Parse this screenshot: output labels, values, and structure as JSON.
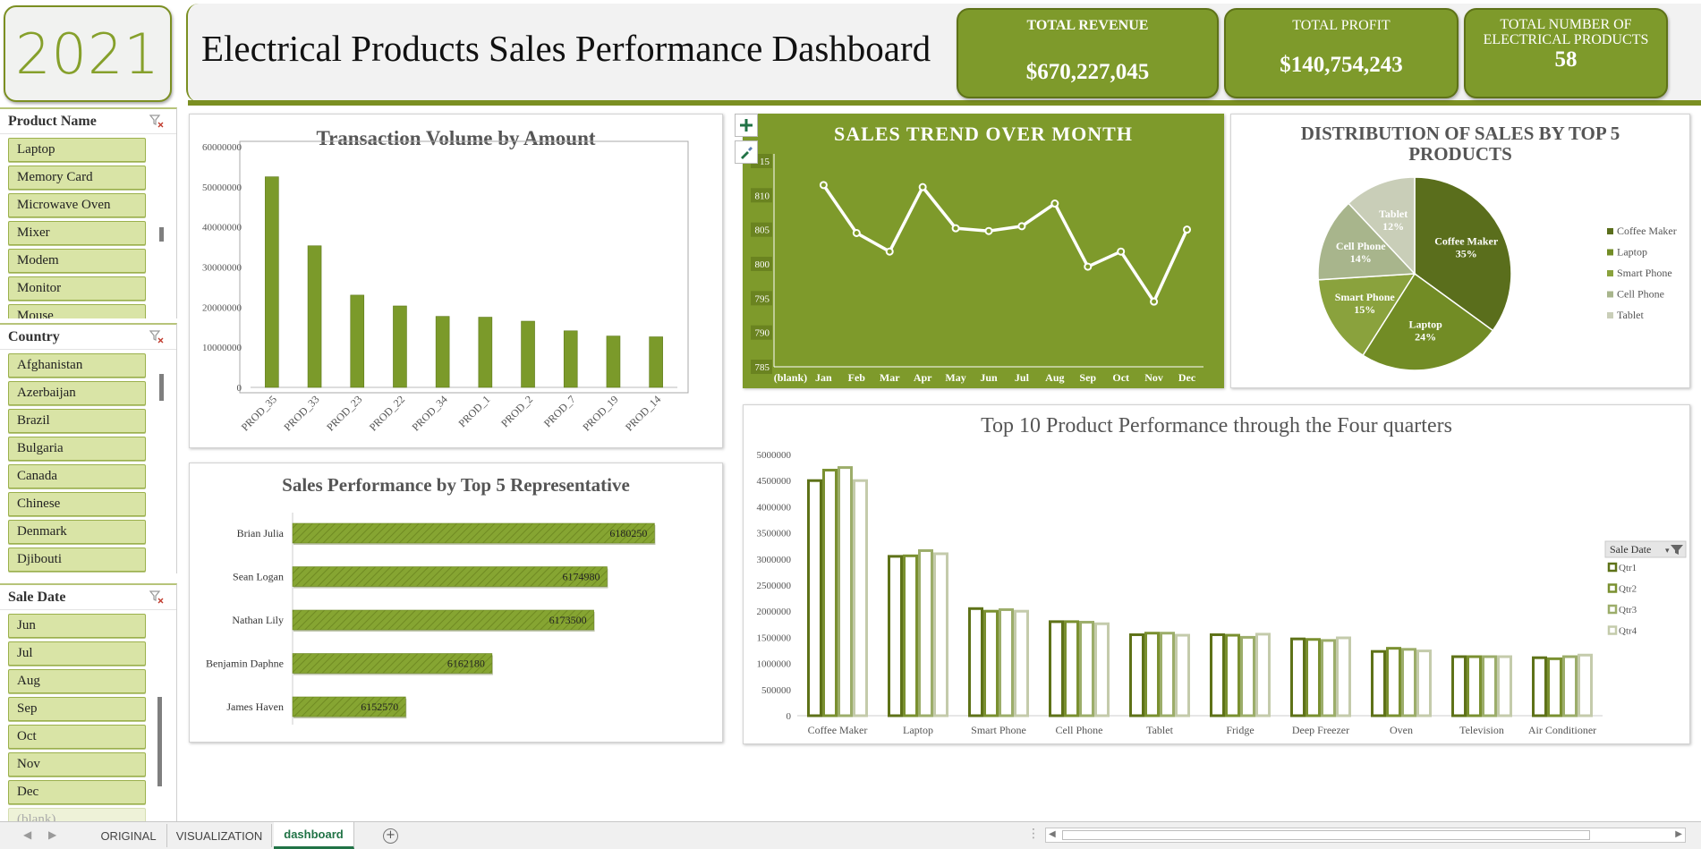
{
  "header": {
    "year": "2021",
    "title": "Electrical Products Sales Performance Dashboard",
    "kpis": {
      "revenue_label": "TOTAL REVENUE",
      "revenue_value": "$670,227,045",
      "profit_label": "TOTAL PROFIT",
      "profit_value": "$140,754,243",
      "count_label_1": "TOTAL NUMBER OF",
      "count_label_2": "ELECTRICAL PRODUCTS",
      "count_value": "58"
    }
  },
  "slicers": {
    "product": {
      "title": "Product Name",
      "items": [
        "Laptop",
        "Memory Card",
        "Microwave Oven",
        "Mixer",
        "Modem",
        "Monitor",
        "Mouse"
      ]
    },
    "country": {
      "title": "Country",
      "items": [
        "Afghanistan",
        "Azerbaijan",
        "Brazil",
        "Bulgaria",
        "Canada",
        "Chinese",
        "Denmark",
        "Djibouti"
      ]
    },
    "sale_date": {
      "title": "Sale Date",
      "items": [
        "Jun",
        "Jul",
        "Aug",
        "Sep",
        "Oct",
        "Nov",
        "Dec",
        "(blank)"
      ]
    }
  },
  "colors": {
    "accent": "#7e9a2b",
    "dark_green": "#5e7218",
    "slicer_item": "#d9e4a6"
  },
  "chart_data": [
    {
      "id": "transaction-volume",
      "type": "bar",
      "title": "Transaction Volume by Amount",
      "categories": [
        "PROD_35",
        "PROD_33",
        "PROD_23",
        "PROD_22",
        "PROD_34",
        "PROD_1",
        "PROD_2",
        "PROD_7",
        "PROD_19",
        "PROD_14"
      ],
      "values": [
        52500000,
        35300000,
        23000000,
        20300000,
        17700000,
        17500000,
        16500000,
        14100000,
        12800000,
        12600000
      ],
      "ylim": [
        0,
        60000000
      ],
      "yticks": [
        "0",
        "10000000",
        "20000000",
        "30000000",
        "40000000",
        "50000000",
        "60000000"
      ]
    },
    {
      "id": "sales-trend",
      "type": "line",
      "title": "SALES TREND OVER MONTH",
      "categories": [
        "(blank)",
        "Jan",
        "Feb",
        "Mar",
        "Apr",
        "May",
        "Jun",
        "Jul",
        "Aug",
        "Sep",
        "Oct",
        "Nov",
        "Dec"
      ],
      "values": [
        null,
        811.5,
        804.5,
        801.8,
        811.2,
        805.2,
        804.8,
        805.5,
        808.8,
        799.6,
        801.8,
        794.5,
        805.0
      ],
      "ylim": [
        785,
        815
      ],
      "yticks": [
        "785",
        "790",
        "795",
        "800",
        "805",
        "810",
        "15"
      ]
    },
    {
      "id": "sales-distribution",
      "type": "pie",
      "title": "DISTRIBUTION OF SALES BY TOP  5 PRODUCTS",
      "labels": [
        "Coffee Maker",
        "Laptop",
        "Smart Phone",
        "Cell Phone",
        "Tablet"
      ],
      "percent_labels": [
        "35%",
        "24%",
        "15%",
        "14%",
        "12%"
      ],
      "values": [
        35,
        24,
        15,
        14,
        12
      ],
      "colors": [
        "#5a6e1c",
        "#728c25",
        "#8aa23d",
        "#a8b58c",
        "#c9ceb8"
      ]
    },
    {
      "id": "rep-performance",
      "type": "bar",
      "orientation": "horizontal",
      "title": "Sales Performance by Top 5 Representative",
      "categories": [
        "Brian Julia",
        "Sean Logan",
        "Nathan Lily",
        "Benjamin Daphne",
        "James Haven"
      ],
      "values": [
        6180250,
        6174980,
        6173500,
        6162180,
        6152570
      ],
      "labels": [
        "6180250",
        "6174980",
        "6173500",
        "6162180",
        "6152570"
      ],
      "xlim": [
        6140000,
        6182000
      ]
    },
    {
      "id": "top10-quarters",
      "type": "bar",
      "title": "Top 10 Product Performance through the Four quarters",
      "categories": [
        "Coffee Maker",
        "Laptop",
        "Smart Phone",
        "Cell Phone",
        "Tablet",
        "Fridge",
        "Deep Freezer",
        "Oven",
        "Television",
        "Air Conditioner"
      ],
      "series": [
        {
          "name": "Qtr1",
          "values": [
            4500000,
            3050000,
            2050000,
            1800000,
            1550000,
            1550000,
            1470000,
            1230000,
            1130000,
            1110000
          ],
          "color": "#5e7218"
        },
        {
          "name": "Qtr2",
          "values": [
            4700000,
            3060000,
            2000000,
            1800000,
            1580000,
            1540000,
            1460000,
            1290000,
            1130000,
            1090000
          ],
          "color": "#7a9030"
        },
        {
          "name": "Qtr3",
          "values": [
            4750000,
            3160000,
            2030000,
            1790000,
            1580000,
            1500000,
            1440000,
            1270000,
            1130000,
            1130000
          ],
          "color": "#9cad6a"
        },
        {
          "name": "Qtr4",
          "values": [
            4500000,
            3100000,
            2000000,
            1760000,
            1540000,
            1560000,
            1490000,
            1240000,
            1130000,
            1160000
          ],
          "color": "#c4cbab"
        }
      ],
      "ylim": [
        0,
        5000000
      ],
      "yticks": [
        "0",
        "500000",
        "1000000",
        "1500000",
        "2000000",
        "2500000",
        "3000000",
        "3500000",
        "4000000",
        "4500000",
        "5000000"
      ],
      "legend_title": "Sale Date",
      "legend_position": "right"
    }
  ],
  "sheet_tabs": [
    "ORIGINAL",
    "VISUALIZATION",
    "dashboard"
  ],
  "active_tab": "dashboard"
}
